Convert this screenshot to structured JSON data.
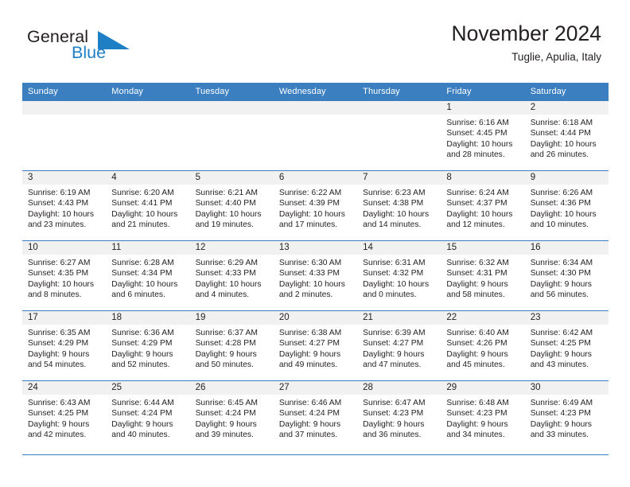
{
  "brand": {
    "name_part1": "General",
    "name_part2": "Blue",
    "logo_icon": "triangle-flag-icon",
    "color_primary": "#1f7fc4",
    "color_text": "#231f20"
  },
  "header": {
    "title": "November 2024",
    "subtitle": "Tuglie, Apulia, Italy"
  },
  "calendar": {
    "header_bg": "#3b7fc0",
    "daynum_bg": "#f1f1f1",
    "weekdays": [
      "Sunday",
      "Monday",
      "Tuesday",
      "Wednesday",
      "Thursday",
      "Friday",
      "Saturday"
    ],
    "weeks": [
      [
        {
          "day": "",
          "sunrise": "",
          "sunset": "",
          "daylight_line1": "",
          "daylight_line2": "",
          "empty": true
        },
        {
          "day": "",
          "sunrise": "",
          "sunset": "",
          "daylight_line1": "",
          "daylight_line2": "",
          "empty": true
        },
        {
          "day": "",
          "sunrise": "",
          "sunset": "",
          "daylight_line1": "",
          "daylight_line2": "",
          "empty": true
        },
        {
          "day": "",
          "sunrise": "",
          "sunset": "",
          "daylight_line1": "",
          "daylight_line2": "",
          "empty": true
        },
        {
          "day": "",
          "sunrise": "",
          "sunset": "",
          "daylight_line1": "",
          "daylight_line2": "",
          "empty": true
        },
        {
          "day": "1",
          "sunrise": "Sunrise: 6:16 AM",
          "sunset": "Sunset: 4:45 PM",
          "daylight_line1": "Daylight: 10 hours",
          "daylight_line2": "and 28 minutes.",
          "empty": false
        },
        {
          "day": "2",
          "sunrise": "Sunrise: 6:18 AM",
          "sunset": "Sunset: 4:44 PM",
          "daylight_line1": "Daylight: 10 hours",
          "daylight_line2": "and 26 minutes.",
          "empty": false
        }
      ],
      [
        {
          "day": "3",
          "sunrise": "Sunrise: 6:19 AM",
          "sunset": "Sunset: 4:43 PM",
          "daylight_line1": "Daylight: 10 hours",
          "daylight_line2": "and 23 minutes.",
          "empty": false
        },
        {
          "day": "4",
          "sunrise": "Sunrise: 6:20 AM",
          "sunset": "Sunset: 4:41 PM",
          "daylight_line1": "Daylight: 10 hours",
          "daylight_line2": "and 21 minutes.",
          "empty": false
        },
        {
          "day": "5",
          "sunrise": "Sunrise: 6:21 AM",
          "sunset": "Sunset: 4:40 PM",
          "daylight_line1": "Daylight: 10 hours",
          "daylight_line2": "and 19 minutes.",
          "empty": false
        },
        {
          "day": "6",
          "sunrise": "Sunrise: 6:22 AM",
          "sunset": "Sunset: 4:39 PM",
          "daylight_line1": "Daylight: 10 hours",
          "daylight_line2": "and 17 minutes.",
          "empty": false
        },
        {
          "day": "7",
          "sunrise": "Sunrise: 6:23 AM",
          "sunset": "Sunset: 4:38 PM",
          "daylight_line1": "Daylight: 10 hours",
          "daylight_line2": "and 14 minutes.",
          "empty": false
        },
        {
          "day": "8",
          "sunrise": "Sunrise: 6:24 AM",
          "sunset": "Sunset: 4:37 PM",
          "daylight_line1": "Daylight: 10 hours",
          "daylight_line2": "and 12 minutes.",
          "empty": false
        },
        {
          "day": "9",
          "sunrise": "Sunrise: 6:26 AM",
          "sunset": "Sunset: 4:36 PM",
          "daylight_line1": "Daylight: 10 hours",
          "daylight_line2": "and 10 minutes.",
          "empty": false
        }
      ],
      [
        {
          "day": "10",
          "sunrise": "Sunrise: 6:27 AM",
          "sunset": "Sunset: 4:35 PM",
          "daylight_line1": "Daylight: 10 hours",
          "daylight_line2": "and 8 minutes.",
          "empty": false
        },
        {
          "day": "11",
          "sunrise": "Sunrise: 6:28 AM",
          "sunset": "Sunset: 4:34 PM",
          "daylight_line1": "Daylight: 10 hours",
          "daylight_line2": "and 6 minutes.",
          "empty": false
        },
        {
          "day": "12",
          "sunrise": "Sunrise: 6:29 AM",
          "sunset": "Sunset: 4:33 PM",
          "daylight_line1": "Daylight: 10 hours",
          "daylight_line2": "and 4 minutes.",
          "empty": false
        },
        {
          "day": "13",
          "sunrise": "Sunrise: 6:30 AM",
          "sunset": "Sunset: 4:33 PM",
          "daylight_line1": "Daylight: 10 hours",
          "daylight_line2": "and 2 minutes.",
          "empty": false
        },
        {
          "day": "14",
          "sunrise": "Sunrise: 6:31 AM",
          "sunset": "Sunset: 4:32 PM",
          "daylight_line1": "Daylight: 10 hours",
          "daylight_line2": "and 0 minutes.",
          "empty": false
        },
        {
          "day": "15",
          "sunrise": "Sunrise: 6:32 AM",
          "sunset": "Sunset: 4:31 PM",
          "daylight_line1": "Daylight: 9 hours",
          "daylight_line2": "and 58 minutes.",
          "empty": false
        },
        {
          "day": "16",
          "sunrise": "Sunrise: 6:34 AM",
          "sunset": "Sunset: 4:30 PM",
          "daylight_line1": "Daylight: 9 hours",
          "daylight_line2": "and 56 minutes.",
          "empty": false
        }
      ],
      [
        {
          "day": "17",
          "sunrise": "Sunrise: 6:35 AM",
          "sunset": "Sunset: 4:29 PM",
          "daylight_line1": "Daylight: 9 hours",
          "daylight_line2": "and 54 minutes.",
          "empty": false
        },
        {
          "day": "18",
          "sunrise": "Sunrise: 6:36 AM",
          "sunset": "Sunset: 4:29 PM",
          "daylight_line1": "Daylight: 9 hours",
          "daylight_line2": "and 52 minutes.",
          "empty": false
        },
        {
          "day": "19",
          "sunrise": "Sunrise: 6:37 AM",
          "sunset": "Sunset: 4:28 PM",
          "daylight_line1": "Daylight: 9 hours",
          "daylight_line2": "and 50 minutes.",
          "empty": false
        },
        {
          "day": "20",
          "sunrise": "Sunrise: 6:38 AM",
          "sunset": "Sunset: 4:27 PM",
          "daylight_line1": "Daylight: 9 hours",
          "daylight_line2": "and 49 minutes.",
          "empty": false
        },
        {
          "day": "21",
          "sunrise": "Sunrise: 6:39 AM",
          "sunset": "Sunset: 4:27 PM",
          "daylight_line1": "Daylight: 9 hours",
          "daylight_line2": "and 47 minutes.",
          "empty": false
        },
        {
          "day": "22",
          "sunrise": "Sunrise: 6:40 AM",
          "sunset": "Sunset: 4:26 PM",
          "daylight_line1": "Daylight: 9 hours",
          "daylight_line2": "and 45 minutes.",
          "empty": false
        },
        {
          "day": "23",
          "sunrise": "Sunrise: 6:42 AM",
          "sunset": "Sunset: 4:25 PM",
          "daylight_line1": "Daylight: 9 hours",
          "daylight_line2": "and 43 minutes.",
          "empty": false
        }
      ],
      [
        {
          "day": "24",
          "sunrise": "Sunrise: 6:43 AM",
          "sunset": "Sunset: 4:25 PM",
          "daylight_line1": "Daylight: 9 hours",
          "daylight_line2": "and 42 minutes.",
          "empty": false
        },
        {
          "day": "25",
          "sunrise": "Sunrise: 6:44 AM",
          "sunset": "Sunset: 4:24 PM",
          "daylight_line1": "Daylight: 9 hours",
          "daylight_line2": "and 40 minutes.",
          "empty": false
        },
        {
          "day": "26",
          "sunrise": "Sunrise: 6:45 AM",
          "sunset": "Sunset: 4:24 PM",
          "daylight_line1": "Daylight: 9 hours",
          "daylight_line2": "and 39 minutes.",
          "empty": false
        },
        {
          "day": "27",
          "sunrise": "Sunrise: 6:46 AM",
          "sunset": "Sunset: 4:24 PM",
          "daylight_line1": "Daylight: 9 hours",
          "daylight_line2": "and 37 minutes.",
          "empty": false
        },
        {
          "day": "28",
          "sunrise": "Sunrise: 6:47 AM",
          "sunset": "Sunset: 4:23 PM",
          "daylight_line1": "Daylight: 9 hours",
          "daylight_line2": "and 36 minutes.",
          "empty": false
        },
        {
          "day": "29",
          "sunrise": "Sunrise: 6:48 AM",
          "sunset": "Sunset: 4:23 PM",
          "daylight_line1": "Daylight: 9 hours",
          "daylight_line2": "and 34 minutes.",
          "empty": false
        },
        {
          "day": "30",
          "sunrise": "Sunrise: 6:49 AM",
          "sunset": "Sunset: 4:23 PM",
          "daylight_line1": "Daylight: 9 hours",
          "daylight_line2": "and 33 minutes.",
          "empty": false
        }
      ]
    ]
  }
}
